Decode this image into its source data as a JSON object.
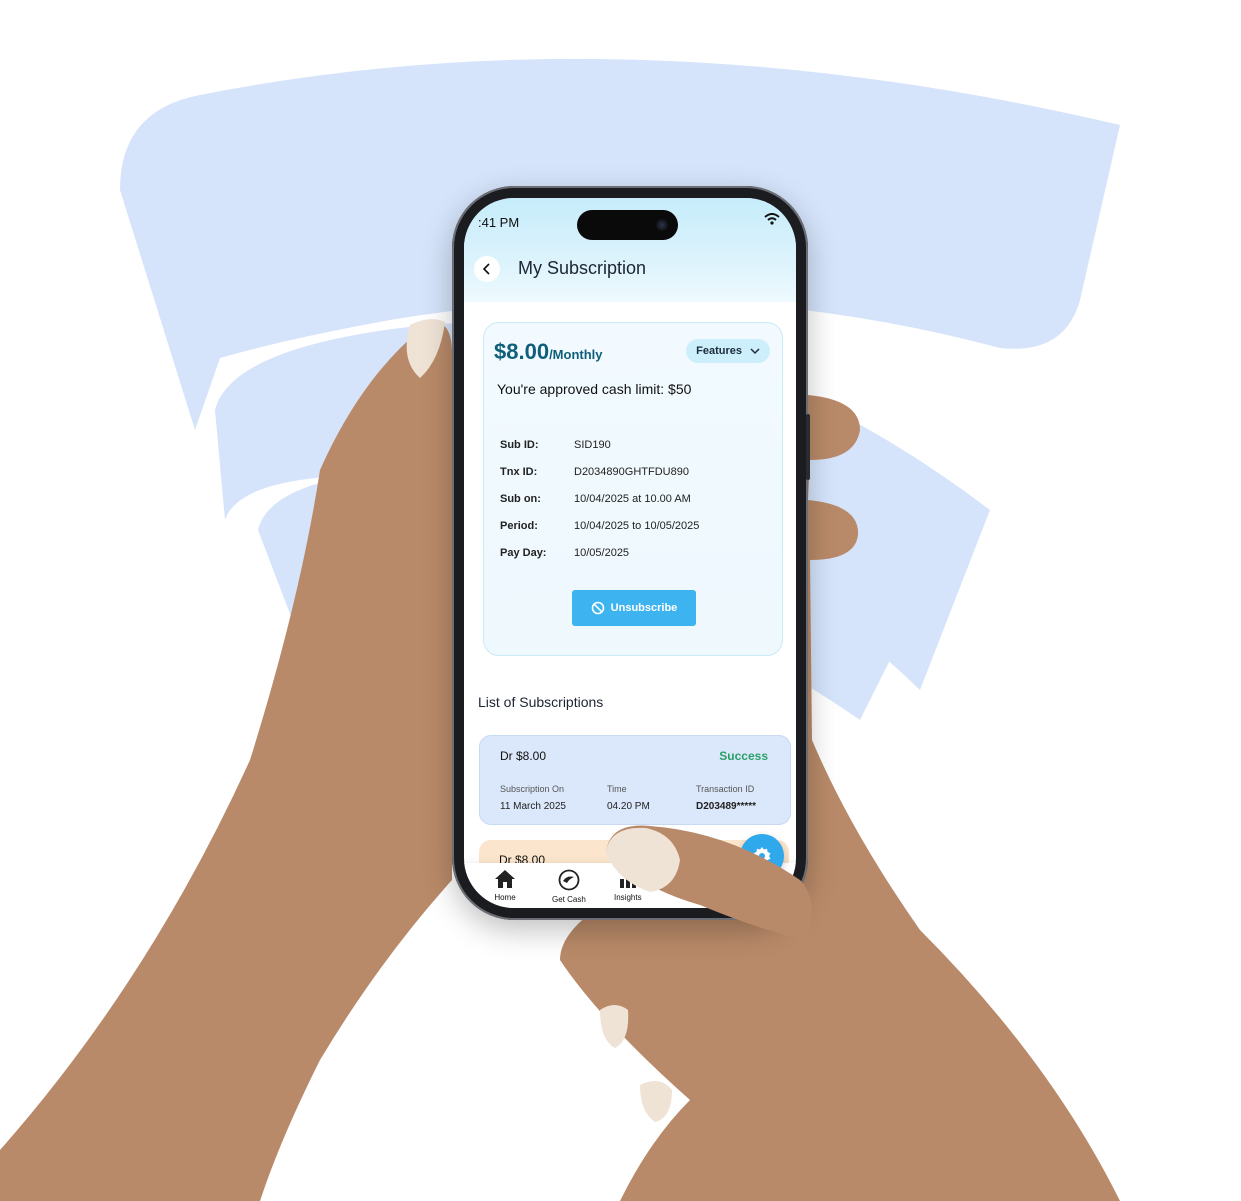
{
  "status": {
    "time": ":41 PM"
  },
  "header": {
    "title": "My Subscription"
  },
  "plan": {
    "price": "$8.00",
    "period": "/Monthly",
    "features_label": "Features",
    "limit_text": "You're approved cash limit: $50",
    "details": [
      {
        "label": "Sub ID:",
        "value": "SID190"
      },
      {
        "label": "Tnx ID:",
        "value": "D2034890GHTFDU890"
      },
      {
        "label": "Sub on:",
        "value": "10/04/2025 at 10.00 AM"
      },
      {
        "label": "Period:",
        "value": "10/04/2025 to 10/05/2025"
      },
      {
        "label": "Pay Day:",
        "value": "10/05/2025"
      }
    ],
    "unsubscribe_label": "Unsubscribe"
  },
  "list": {
    "title": "List of Subscriptions",
    "items": [
      {
        "amount": "Dr $8.00",
        "status": "Success",
        "subscription_on_label": "Subscription On",
        "subscription_on": "11 March 2025",
        "time_label": "Time",
        "time": "04.20 PM",
        "transaction_label": "Transaction ID",
        "transaction_id": "D203489*****"
      },
      {
        "amount": "Dr $8.00"
      }
    ]
  },
  "nav": {
    "items": [
      {
        "label": "Home",
        "icon": "home-icon"
      },
      {
        "label": "Get Cash",
        "icon": "get-cash-icon"
      },
      {
        "label": "Insights",
        "icon": "insights-icon"
      }
    ],
    "fab_icon": "gear-icon"
  },
  "colors": {
    "accent": "#3db3ef",
    "price": "#0f5f7a",
    "success": "#2ba06a",
    "background_logo": "#d5e4fb"
  }
}
